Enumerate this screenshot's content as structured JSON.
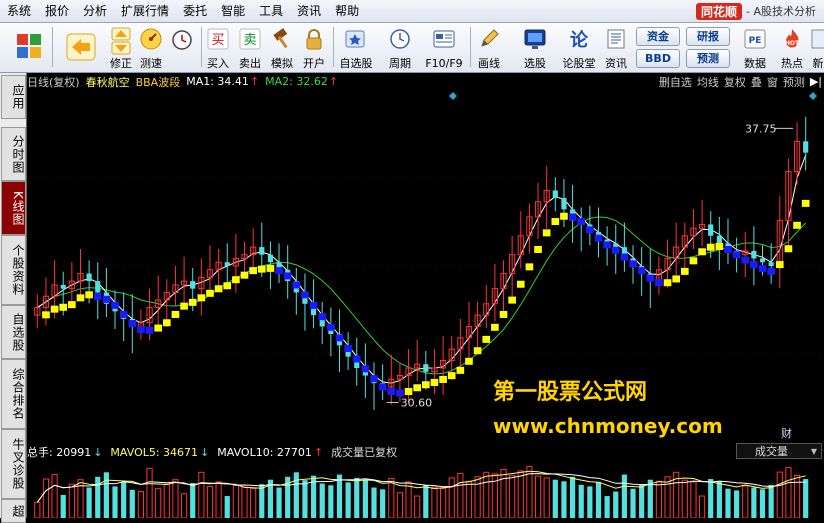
{
  "menubar": {
    "items": [
      "系统",
      "报价",
      "分析",
      "扩展行情",
      "委托",
      "智能",
      "工具",
      "资讯",
      "帮助"
    ],
    "brand_logo": "同花顺",
    "brand_sub": "- A股技术分析"
  },
  "toolbar": {
    "buttons": [
      {
        "label": "",
        "icon": "grid-icon"
      },
      {
        "label": "",
        "icon": "back-arrow-icon"
      },
      {
        "label": "修正",
        "icon": "up-down-arrow-icon"
      },
      {
        "label": "测速",
        "icon": "speed-icon"
      },
      {
        "label": "买入",
        "icon": "buy-icon"
      },
      {
        "label": "卖出",
        "icon": "sell-icon"
      },
      {
        "label": "模拟",
        "icon": "hammer-icon"
      },
      {
        "label": "开户",
        "icon": "lock-icon"
      },
      {
        "label": "自选股",
        "icon": "star-icon"
      },
      {
        "label": "周期",
        "icon": "clock-icon"
      },
      {
        "label": "F10/F9",
        "icon": "f10-icon"
      },
      {
        "label": "画线",
        "icon": "pencil-icon"
      },
      {
        "label": "选股",
        "icon": "screen-icon"
      },
      {
        "label": "论股堂",
        "icon": "forum-icon"
      },
      {
        "label": "资讯",
        "icon": "news-icon"
      },
      {
        "label": "数据",
        "icon": "pe-icon"
      },
      {
        "label": "热点",
        "icon": "hot-icon"
      },
      {
        "label": "新",
        "icon": "new-icon"
      }
    ],
    "pills": [
      "资金",
      "研报",
      "BBD",
      "预测"
    ],
    "glyphs": {
      "buy": "买",
      "sell": "卖",
      "forum": "论",
      "pe": "PE",
      "hot": "HOT"
    }
  },
  "sidebar": {
    "tabs": [
      "应用",
      "分时图",
      "K线图",
      "个股资料",
      "自选股",
      "综合排名",
      "牛叉诊股",
      "超"
    ],
    "active_index": 2
  },
  "chart_header": {
    "period": "日线(复权)",
    "stock": "春秋航空",
    "indicator": "BBA波段",
    "ma1_label": "MA1: 34.41",
    "ma1_arrow": "↑",
    "ma2_label": "MA2: 32.62",
    "ma2_arrow": "↑"
  },
  "chart_tools": [
    "删自选",
    "均线",
    "复权",
    "叠",
    "窗",
    "预测",
    "▶|"
  ],
  "volume_header": {
    "total": "总手: 20991",
    "total_arrow": "↓",
    "mavol5": "MAVOL5: 34671",
    "mavol5_arrow": "↓",
    "mavol10": "MAVOL10: 27701",
    "mavol10_arrow": "↑",
    "note": "成交量已复权",
    "selector": "成交量"
  },
  "watermark": {
    "line1": "第一股票公式网",
    "line2": "www.chnmoney.com"
  },
  "cai_label": "财",
  "colors": {
    "up": "#ff3333",
    "down": "#55e0e0",
    "ma1": "#ffffff",
    "ma2": "#33cc33",
    "band_up": "#ffff00",
    "band_down": "#1a1aff",
    "active_tab": "#8b0000",
    "watermark": "#ffd400"
  },
  "chart_data": {
    "type": "candlestick",
    "title": "春秋航空",
    "price_range": [
      29.5,
      38.5
    ],
    "annotations": [
      {
        "label": "37.75",
        "value": 37.75,
        "kind": "high"
      },
      {
        "label": "30.60",
        "value": 30.6,
        "kind": "low"
      }
    ],
    "close": [
      32.9,
      33.2,
      33.5,
      33.4,
      33.6,
      33.8,
      33.6,
      33.3,
      33.0,
      32.8,
      32.6,
      32.4,
      32.5,
      32.9,
      33.1,
      33.3,
      33.5,
      33.6,
      33.4,
      33.7,
      33.9,
      34.1,
      34.0,
      34.2,
      34.3,
      34.5,
      34.3,
      34.1,
      33.9,
      33.6,
      33.3,
      33.0,
      32.7,
      32.4,
      32.2,
      31.9,
      31.6,
      31.3,
      31.1,
      30.9,
      30.8,
      31.0,
      31.1,
      31.3,
      31.4,
      31.2,
      31.3,
      31.5,
      31.8,
      32.1,
      32.4,
      32.7,
      33.0,
      33.4,
      33.8,
      34.3,
      34.8,
      35.3,
      35.7,
      36.0,
      35.8,
      35.5,
      35.2,
      35.1,
      34.9,
      34.7,
      34.6,
      34.5,
      34.2,
      34.0,
      33.8,
      33.6,
      33.9,
      34.2,
      34.5,
      34.8,
      35.0,
      35.1,
      34.8,
      34.6,
      34.4,
      34.3,
      34.4,
      34.2,
      34.1,
      34.0,
      35.2,
      36.5,
      37.3,
      37.0
    ]
  }
}
